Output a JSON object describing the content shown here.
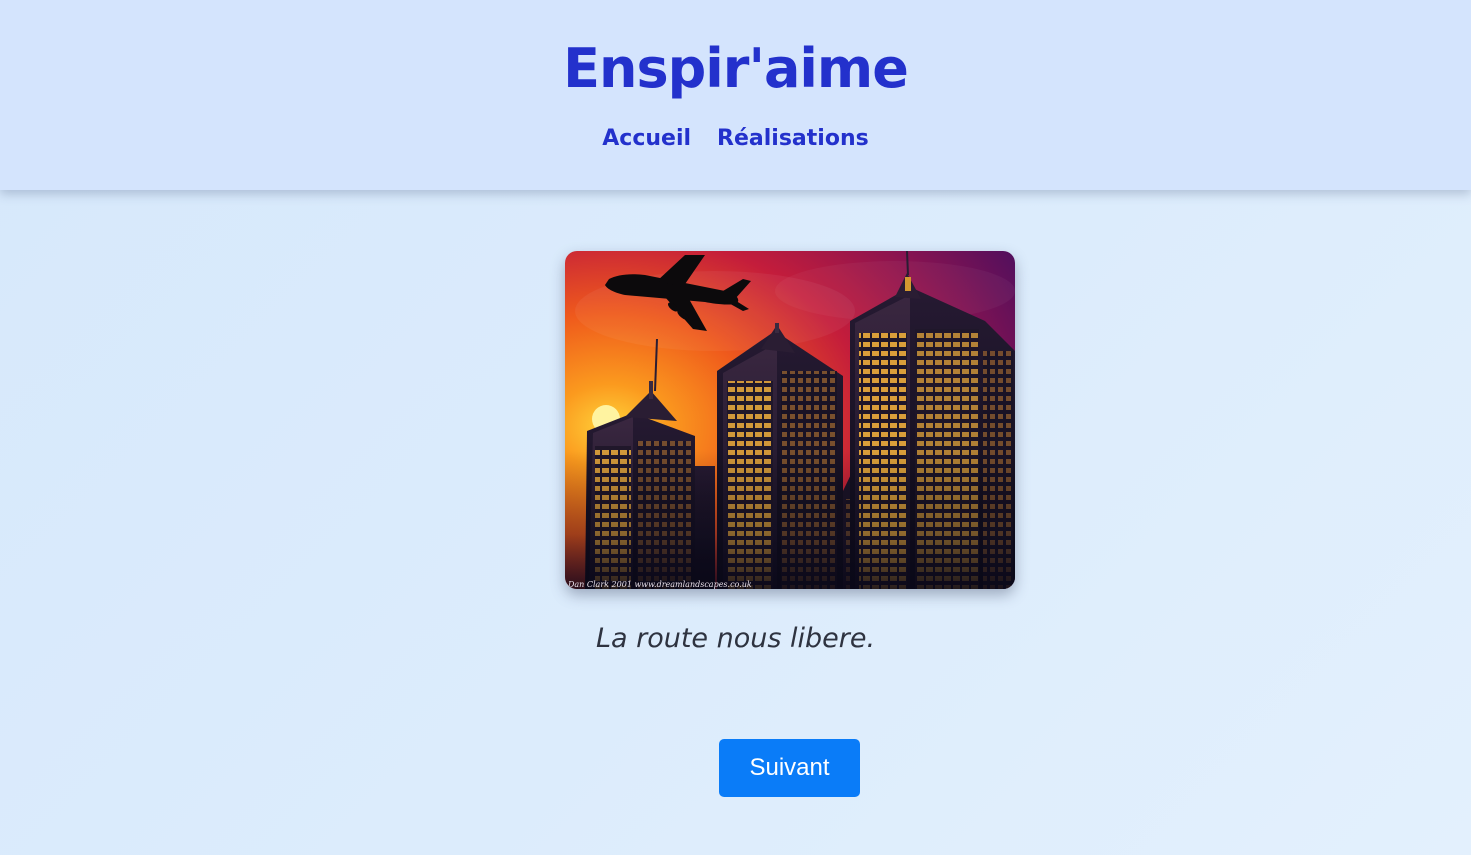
{
  "header": {
    "title": "Enspir'aime",
    "nav": [
      {
        "label": "Accueil"
      },
      {
        "label": "Réalisations"
      }
    ]
  },
  "main": {
    "image": {
      "alt": "",
      "watermark": "Dan Clark 2001   www.dreamlandscapes.co.uk"
    },
    "caption": "La route nous libere.",
    "next_button_label": "Suivant"
  },
  "colors": {
    "header_bg": "#d4e4fd",
    "title_text": "#2331cc",
    "button_bg": "#0a7cf8",
    "button_text": "#ffffff",
    "caption_text": "#2e3340"
  },
  "icons": {
    "photo_subject": "city-skyline-airplane-sunset"
  }
}
